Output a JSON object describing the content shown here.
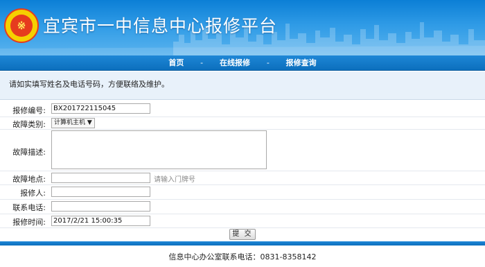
{
  "header": {
    "title": "宜宾市一中信息中心报修平台",
    "logo_char": "※"
  },
  "nav": {
    "items": [
      "首页",
      "在线报修",
      "报修查询"
    ],
    "separator": "-"
  },
  "notice": "请如实填写姓名及电话号码，方便联络及维护。",
  "form": {
    "repair_no_label": "报修编号:",
    "repair_no_value": "BX201722115045",
    "category_label": "故障类别:",
    "category_value": "计算机主机",
    "description_label": "故障描述:",
    "location_label": "故障地点:",
    "location_hint": "请输入门牌号",
    "reporter_label": "报修人:",
    "phone_label": "联系电话:",
    "time_label": "报修时间:",
    "time_value": "2017/2/21 15:00:35",
    "submit_label": "提 交"
  },
  "footer": {
    "text": "信息中心办公室联系电话：0831-8358142"
  },
  "colors": {
    "banner": "#2f9be6",
    "nav": "#0c6fbd",
    "notice_bg": "#e8f1fa"
  }
}
